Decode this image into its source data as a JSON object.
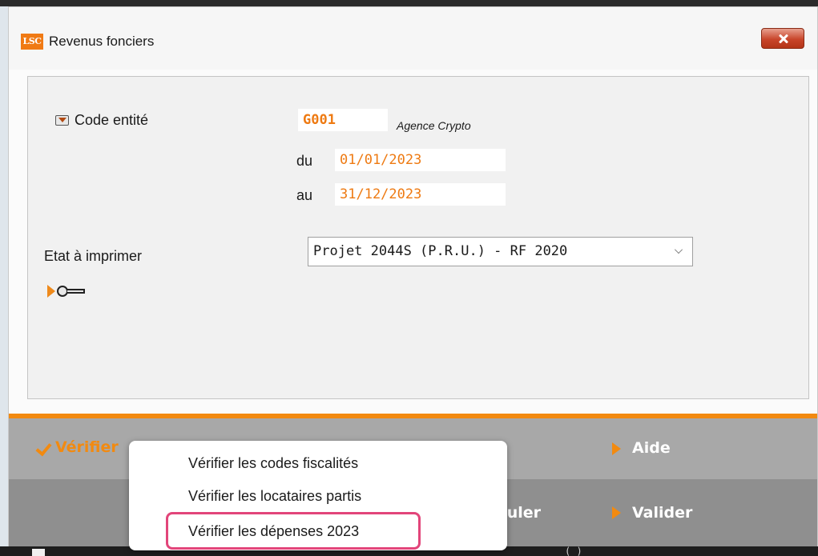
{
  "window": {
    "logo_text": "LSC",
    "title": "Revenus fonciers"
  },
  "form": {
    "code_entite_label": "Code entité",
    "code_entite_value": "G001",
    "entity_name": "Agence Crypto",
    "du_label": "du",
    "du_value": "01/01/2023",
    "au_label": "au",
    "au_value": "31/12/2023",
    "etat_label": "Etat à imprimer",
    "etat_selected": "Projet 2044S (P.R.U.) - RF 2020"
  },
  "toolbar": {
    "verifier_label": "Vérifier",
    "aide_label": "Aide",
    "annuler_label": "Annuler",
    "valider_label": "Valider"
  },
  "menu": {
    "items": [
      {
        "label": "Vérifier les codes fiscalités"
      },
      {
        "label": "Vérifier les locataires partis"
      },
      {
        "label": "Vérifier les dépenses 2023"
      }
    ]
  },
  "colors": {
    "accent": "#f28a10",
    "value_text": "#ee7a12",
    "highlight_border": "#e2457a"
  }
}
